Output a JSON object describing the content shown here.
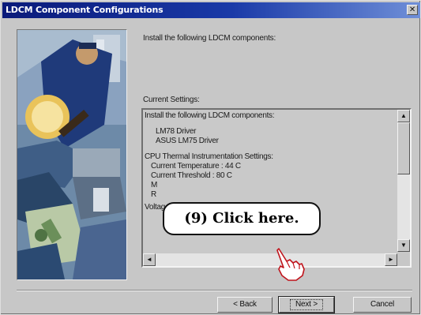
{
  "window": {
    "title": "LDCM Component Configurations",
    "close_glyph": "✕"
  },
  "intro_text": "Install the following LDCM components:",
  "settings": {
    "label": "Current Settings:",
    "lines": [
      "Install the following LDCM components:",
      "LM78 Driver",
      "ASUS LM75 Driver",
      "CPU Thermal Instrumentation Settings:",
      "Current Temperature : 44 C",
      "Current Threshold : 80 C",
      "M",
      "R",
      "Voltage Information:"
    ]
  },
  "scrollbars": {
    "up_glyph": "▲",
    "down_glyph": "▼",
    "left_glyph": "◄",
    "right_glyph": "►"
  },
  "buttons": {
    "back": "< Back",
    "next": "Next >",
    "cancel": "Cancel"
  },
  "callout": {
    "text": "(9)  Click here."
  },
  "icons": {
    "pointer": "pointing-hand-icon",
    "illustration": "wizard-illustration"
  },
  "colors": {
    "titlebar_start": "#0a1a7a",
    "titlebar_end": "#6f8fd8",
    "dialog_bg": "#c7c7c7"
  }
}
